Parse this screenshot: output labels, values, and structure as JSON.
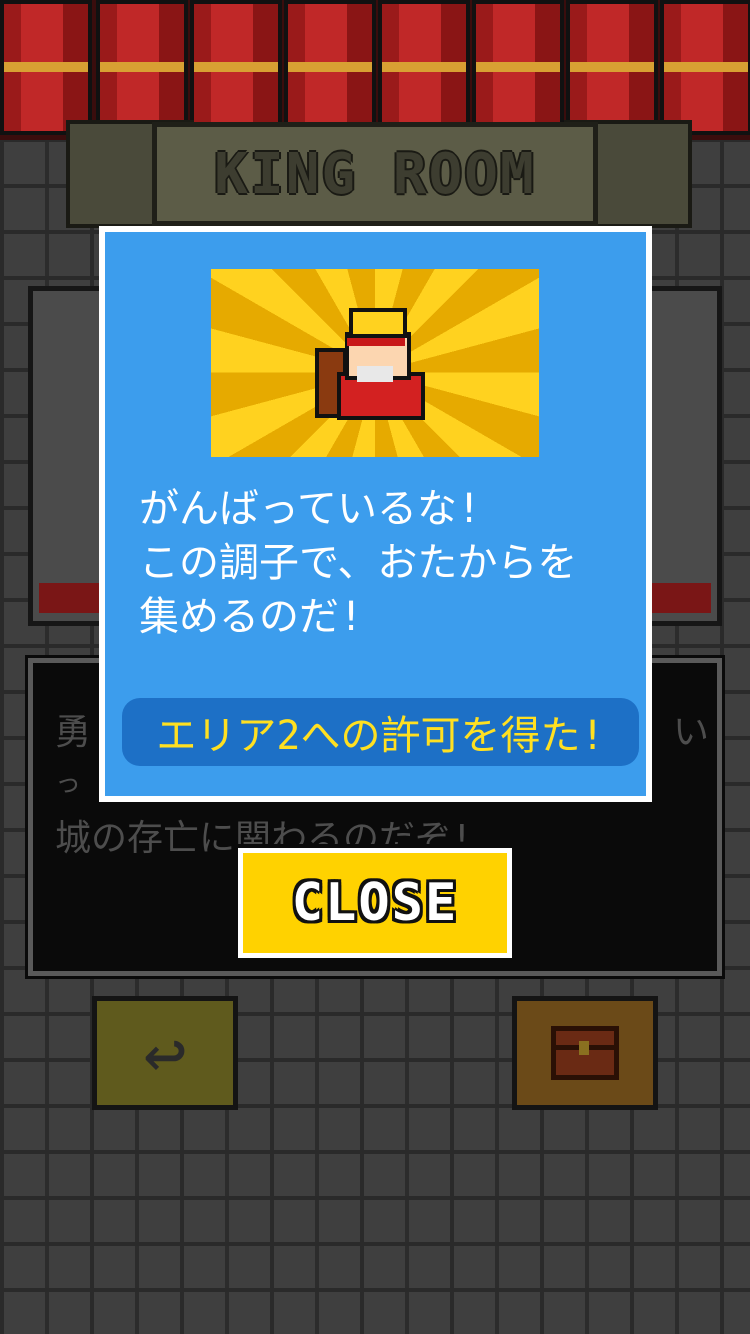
{
  "header": {
    "title": "KING ROOM"
  },
  "dialog_background": {
    "line1": "勇",
    "line1_tail": "い",
    "line2": "っ",
    "line3": "城の存亡に関わるのだぞ!"
  },
  "modal": {
    "message_lines": [
      "がんばっているな!",
      "この調子で、おたからを",
      "集めるのだ!"
    ],
    "reward_text": "エリア2への許可を得た!",
    "art_icon": "king-icon"
  },
  "close_button": {
    "label": "CLOSE"
  },
  "nav": {
    "back_icon": "back-arrow-icon",
    "back_glyph": "↩",
    "chest_icon": "treasure-chest-icon"
  },
  "colors": {
    "modal_bg": "#3c9ded",
    "reward_bg": "#1d70c6",
    "reward_text": "#ffe021",
    "close_bg": "#ffd200",
    "curtain": "#c02828"
  }
}
